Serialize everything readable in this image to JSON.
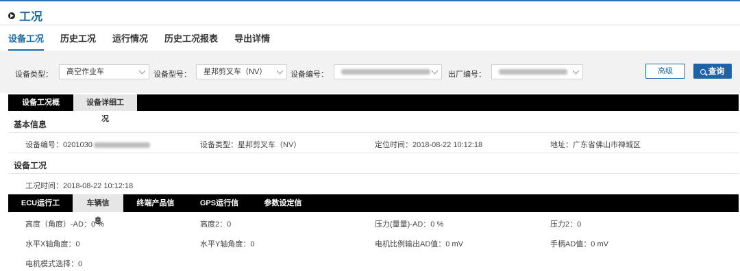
{
  "header": {
    "title": "工况"
  },
  "tabs": [
    "设备工况",
    "历史工况",
    "运行情况",
    "历史工况报表",
    "导出详情"
  ],
  "filters": {
    "type_label": "设备类型：",
    "type_value": "高空作业车",
    "model_label": "设备型号：",
    "model_value": "星邦剪叉车（NV）",
    "id_label": "设备编号：",
    "factory_label": "出厂编号："
  },
  "buttons": {
    "advanced": "高级",
    "query": "查询"
  },
  "view_tabs": [
    "设备工况概览",
    "设备详细工况"
  ],
  "basic": {
    "title": "基本信息",
    "device_id_prefix": "设备编号：0201030",
    "device_type": "设备类型：星邦剪叉车（NV）",
    "locate_time": "定位时间：2018-08-22 10:12:18",
    "address": "地址：广东省佛山市禅城区"
  },
  "condition": {
    "title": "设备工况",
    "time": "工况时间：2018-08-22 10:12:18"
  },
  "sub_tabs": [
    "ECU运行工况",
    "车辆信息",
    "终端产品信息",
    "GPS运行信息",
    "参数设定信息"
  ],
  "readings": [
    "高度（角度）-AD：0 %",
    "高度2：0",
    "压力(量量)-AD：0 %",
    "压力2：0",
    "水平X轴角度：0",
    "水平Y轴角度：0",
    "电机比例输出AD值：0 mV",
    "手柄AD值：0 mV",
    "电机模式选择：0"
  ]
}
